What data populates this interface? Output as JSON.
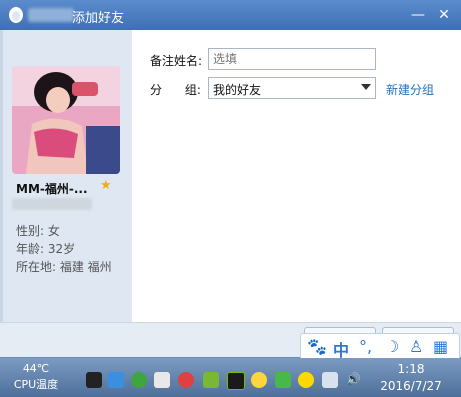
{
  "dialog": {
    "title": "添加好友",
    "minimize_symbol": "—",
    "close_symbol": "✕"
  },
  "profile": {
    "nickname": "MM-福州-...",
    "star_icon": "star-icon",
    "gender": "性别: 女",
    "age": "年龄: 32岁",
    "location": "所在地: 福建  福州"
  },
  "form": {
    "remark_label": "备注姓名:",
    "remark_placeholder": "选填",
    "group_label": "分      组:",
    "group_value": "我的好友",
    "new_group_link": "新建分组"
  },
  "ime": {
    "paw": "🐾",
    "lang": "中",
    "punct": "°,",
    "moon": "☽",
    "user": "♙",
    "grid": "▦"
  },
  "taskbar": {
    "cpu_temp": "44℃",
    "cpu_label": "CPU温度",
    "time": "1:18",
    "date": "2016/7/27",
    "volume_icon": "🔊"
  },
  "colors": {
    "titlebar": "#4b7cc0",
    "link": "#2a6fb8",
    "star": "#e7b20f"
  }
}
